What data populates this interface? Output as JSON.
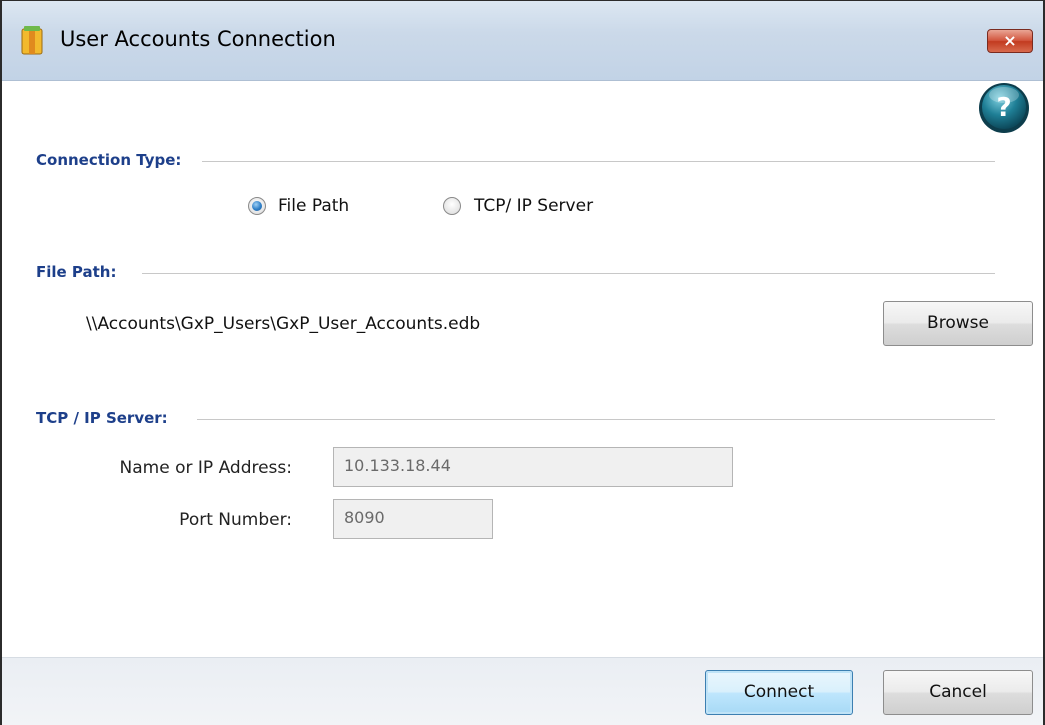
{
  "window": {
    "title": "User Accounts Connection",
    "close_label": "×"
  },
  "help": {
    "label": "?"
  },
  "connection_type": {
    "header": "Connection Type:",
    "options": [
      {
        "label": "File Path",
        "checked": true
      },
      {
        "label": "TCP/ IP Server",
        "checked": false
      }
    ]
  },
  "file_path": {
    "header": "File Path:",
    "value": "\\\\Accounts\\GxP_Users\\GxP_User_Accounts.edb",
    "browse_label": "Browse"
  },
  "tcp_ip": {
    "header": "TCP / IP Server:",
    "name_label": "Name or IP Address:",
    "name_value": "10.133.18.44",
    "port_label": "Port Number:",
    "port_value": "8090"
  },
  "footer": {
    "connect_label": "Connect",
    "cancel_label": "Cancel"
  },
  "colors": {
    "section_header": "#1d3f8a",
    "radio_checked": "#2f7fc7",
    "close_button": "#c23a1f",
    "help_icon": "#1a6a84"
  }
}
